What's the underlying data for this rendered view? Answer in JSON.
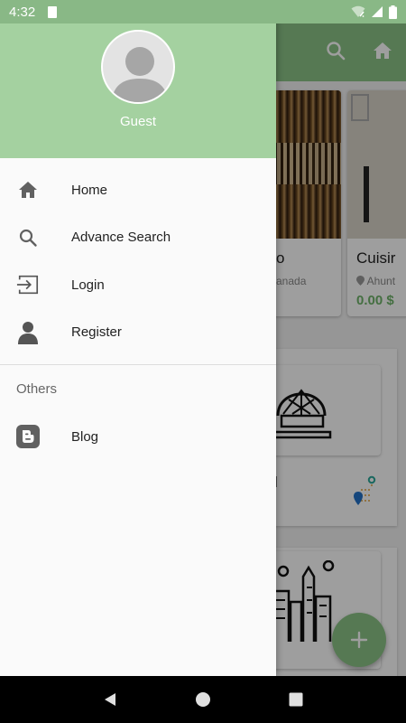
{
  "status_bar": {
    "time": "4:32"
  },
  "drawer": {
    "user_name": "Guest",
    "menu_items": [
      {
        "label": "Home",
        "icon": "home-icon"
      },
      {
        "label": "Advance Search",
        "icon": "search-icon"
      },
      {
        "label": "Login",
        "icon": "login-icon"
      },
      {
        "label": "Register",
        "icon": "person-icon"
      }
    ],
    "section_title": "Others",
    "others_items": [
      {
        "label": "Blog",
        "icon": "blogger-icon"
      }
    ]
  },
  "background": {
    "cards": [
      {
        "title": "o",
        "location": "anada",
        "price": ""
      },
      {
        "title": "Cuisir",
        "location": "Ahunt",
        "price": "0.00 $"
      }
    ],
    "category_text": "l"
  },
  "colors": {
    "accent": "#8cc387",
    "header": "#a4d1a0",
    "price": "#6fb36a"
  }
}
